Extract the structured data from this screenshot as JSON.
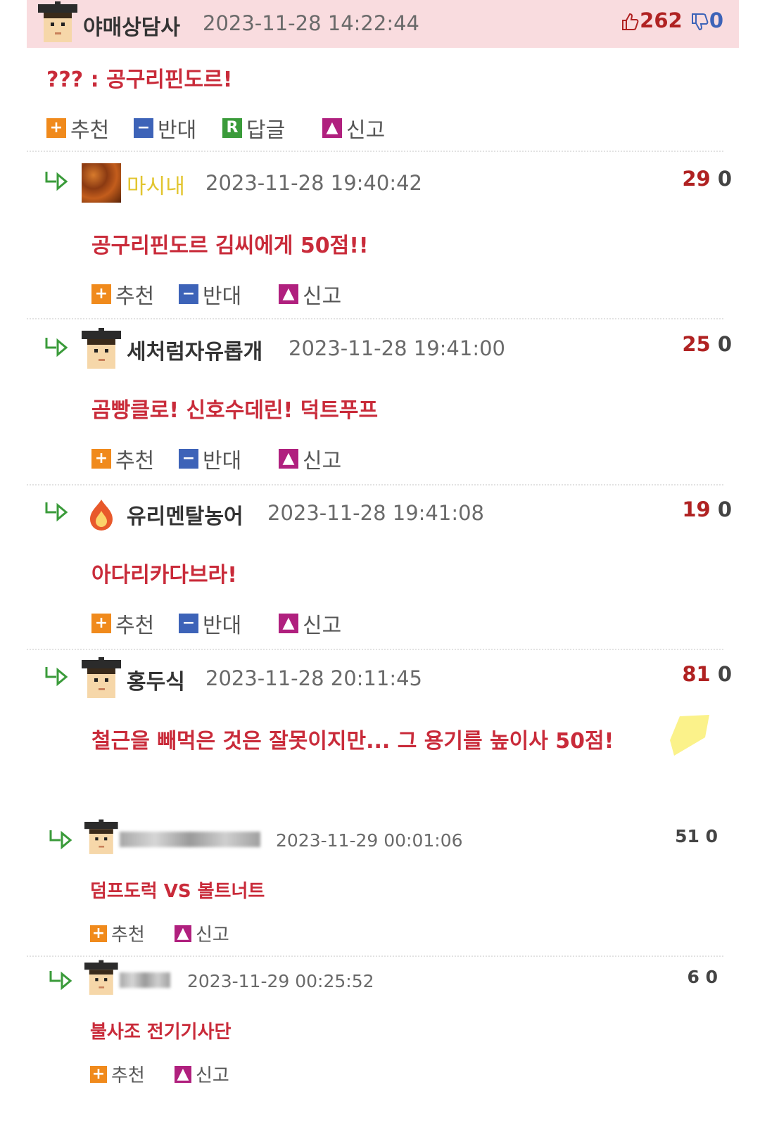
{
  "post": {
    "nickname": "야매상담사",
    "datetime": "2023-11-28 14:22:44",
    "likes": "262",
    "dislikes": "0",
    "content": "??? : 공구리핀도르!",
    "actions": {
      "recommend": "추천",
      "oppose": "반대",
      "reply": "답글",
      "report": "신고"
    }
  },
  "replies": [
    {
      "nickname": "마시내",
      "datetime": "2023-11-28 19:40:42",
      "likes": "29",
      "dislikes": "0",
      "content": "공구리핀도르 김씨에게 50점!!",
      "recommend": "추천",
      "oppose": "반대",
      "report": "신고"
    },
    {
      "nickname": "세처럼자유롭개",
      "datetime": "2023-11-28 19:41:00",
      "likes": "25",
      "dislikes": "0",
      "content": "곰빵클로! 신호수데린! 덕트푸프",
      "recommend": "추천",
      "oppose": "반대",
      "report": "신고"
    },
    {
      "nickname": "유리멘탈농어",
      "datetime": "2023-11-28 19:41:08",
      "likes": "19",
      "dislikes": "0",
      "content": "아다리카다브라!",
      "recommend": "추천",
      "oppose": "반대",
      "report": "신고"
    },
    {
      "nickname": "홍두식",
      "datetime": "2023-11-28 20:11:45",
      "likes": "81",
      "dislikes": "0",
      "content": "철근을 빼먹은 것은 잘못이지만... 그 용기를 높이사 50점!"
    },
    {
      "datetime": "2023-11-29 00:01:06",
      "likes": "51",
      "dislikes": "0",
      "content": "덤프도럭 VS 볼트너트",
      "recommend": "추천",
      "report": "신고"
    },
    {
      "datetime": "2023-11-29 00:25:52",
      "likes": "6",
      "dislikes": "0",
      "content": "불사조 전기기사단",
      "recommend": "추천",
      "report": "신고"
    }
  ],
  "icons": {
    "reply_arrow": "reply-arrow-icon",
    "thumbs_up": "thumbs-up-icon",
    "thumbs_down": "thumbs-down-icon"
  },
  "colors": {
    "header_bg": "#f9dcdf",
    "content_text": "#c92b3a",
    "recommend_icon": "#f08a1c",
    "oppose_icon": "#3d63b8",
    "reply_icon": "#3a9b3a",
    "report_icon": "#b0207e",
    "likes": "#b02222"
  }
}
